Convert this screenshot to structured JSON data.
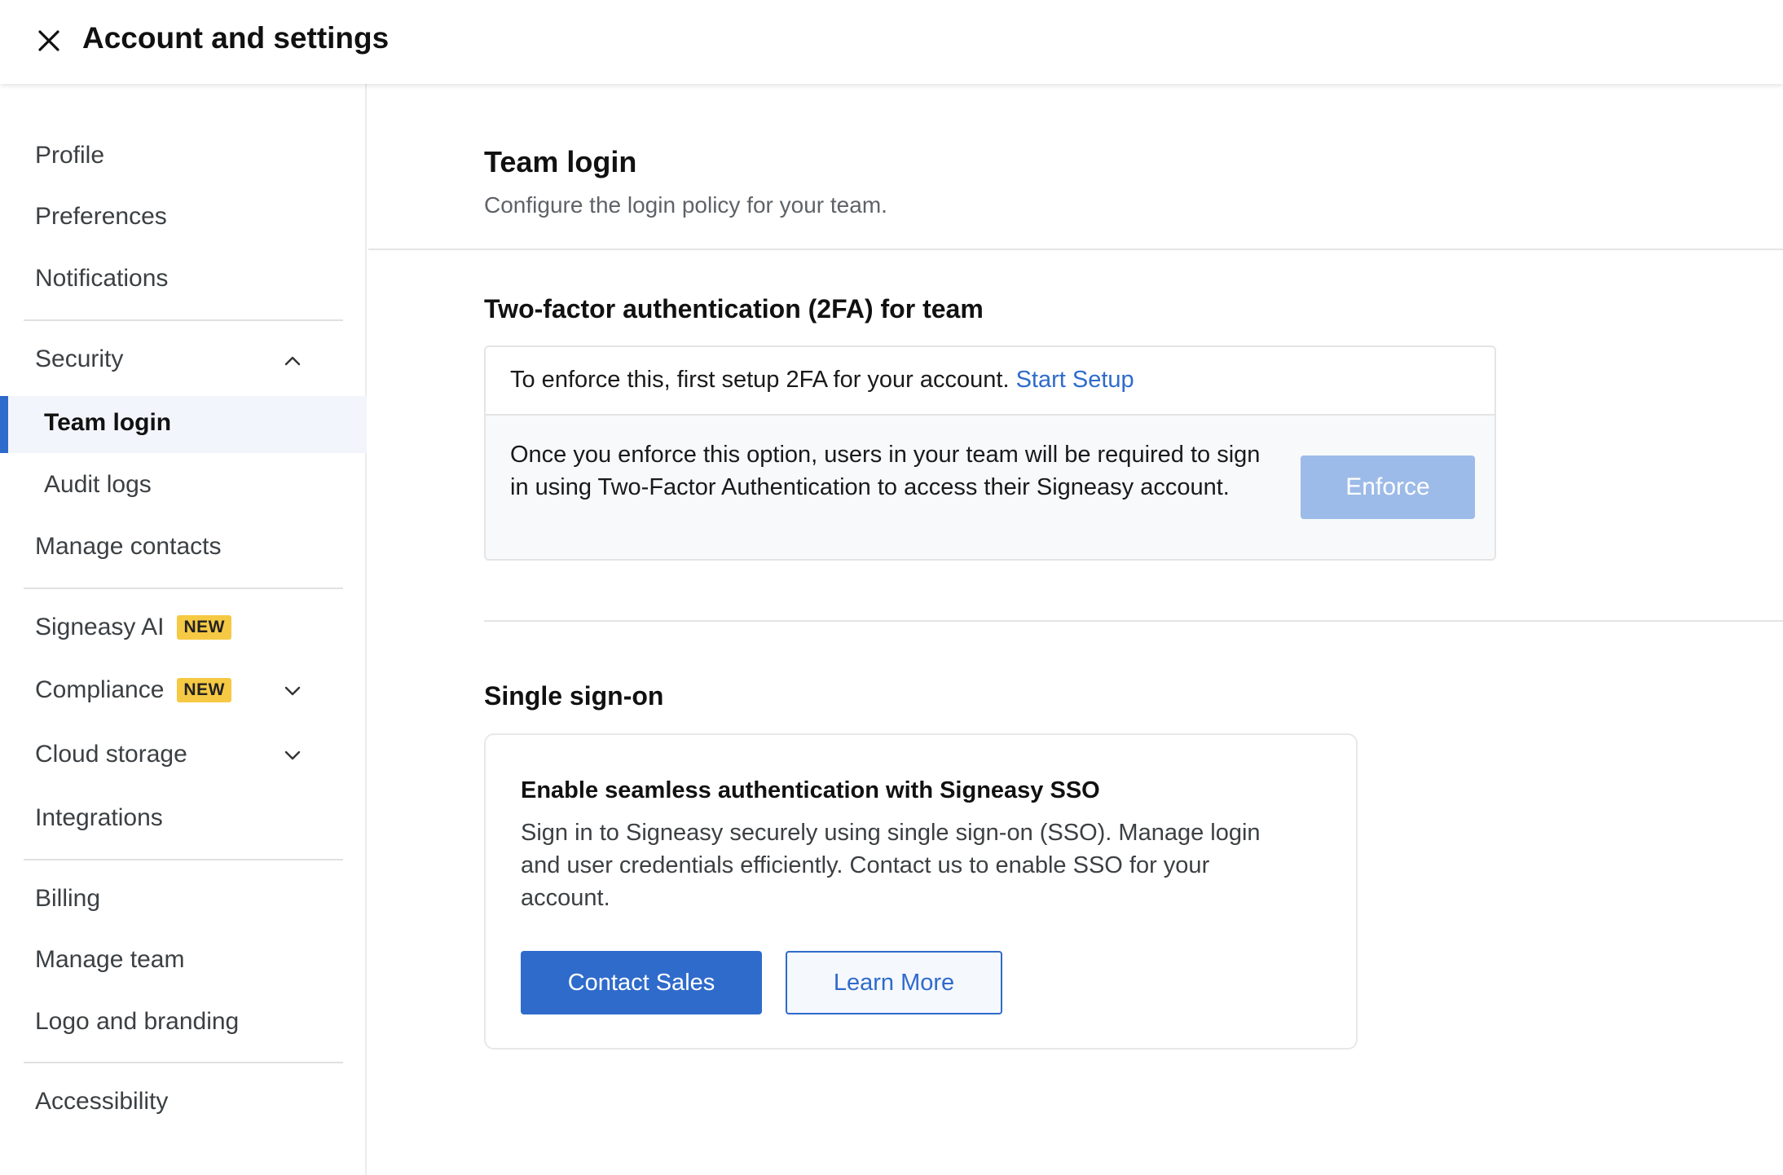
{
  "header": {
    "title": "Account and settings",
    "close_icon": "close-icon"
  },
  "sidebar": {
    "items": [
      {
        "label": "Profile"
      },
      {
        "label": "Preferences"
      },
      {
        "label": "Notifications"
      },
      {
        "label": "Security",
        "expanded": true
      },
      {
        "label": "Team login",
        "active": true
      },
      {
        "label": "Audit logs"
      },
      {
        "label": "Manage contacts"
      },
      {
        "label": "Signeasy AI",
        "badge": "NEW"
      },
      {
        "label": "Compliance",
        "badge": "NEW"
      },
      {
        "label": "Cloud storage"
      },
      {
        "label": "Integrations"
      },
      {
        "label": "Billing"
      },
      {
        "label": "Manage team"
      },
      {
        "label": "Logo and branding"
      },
      {
        "label": "Accessibility"
      }
    ]
  },
  "main": {
    "title": "Team login",
    "subtitle": "Configure the login policy for your team.",
    "two_factor": {
      "title": "Two-factor authentication (2FA) for team",
      "notice": "To enforce this, first setup 2FA for your account.",
      "setup_link": "Start Setup",
      "description": "Once you enforce this option, users in your team will be required to sign in using Two-Factor Authentication to access their Signeasy account.",
      "enforce_label": "Enforce"
    },
    "sso": {
      "title": "Single sign-on",
      "heading": "Enable seamless authentication with Signeasy SSO",
      "description": "Sign in to Signeasy securely using single sign-on (SSO). Manage login and user credentials efficiently. Contact us to enable SSO for your account.",
      "contact_label": "Contact Sales",
      "learn_label": "Learn More"
    }
  },
  "colors": {
    "accent": "#2f6bcb",
    "accent_disabled": "#9dbbe8",
    "badge": "#f6c944",
    "active_bg": "#f2f5fb"
  }
}
